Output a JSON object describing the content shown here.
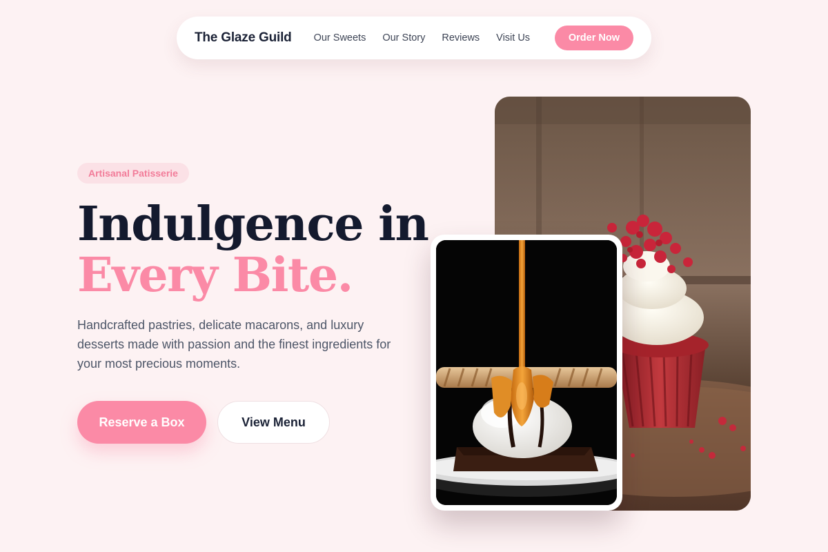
{
  "nav": {
    "brand": "The Glaze Guild",
    "links": [
      "Our Sweets",
      "Our Story",
      "Reviews",
      "Visit Us"
    ],
    "cta": "Order Now"
  },
  "hero": {
    "badge": "Artisanal Patisserie",
    "headline_line1": "Indulgence in",
    "headline_line2": "Every Bite.",
    "description": "Handcrafted pastries, delicate macarons, and luxury desserts made with passion and the finest ingredients for your most precious moments.",
    "primary_button": "Reserve a Box",
    "secondary_button": "View Menu"
  },
  "images": {
    "back_photo": "red-velvet-cupcake-photo",
    "front_photo": "caramel-ice-cream-brownie-photo"
  },
  "colors": {
    "background": "#fdf2f3",
    "accent_pink": "#fb8aa6",
    "badge_bg": "#fbe1e6",
    "heading_dark": "#141a2e",
    "body_text": "#4c5567"
  }
}
